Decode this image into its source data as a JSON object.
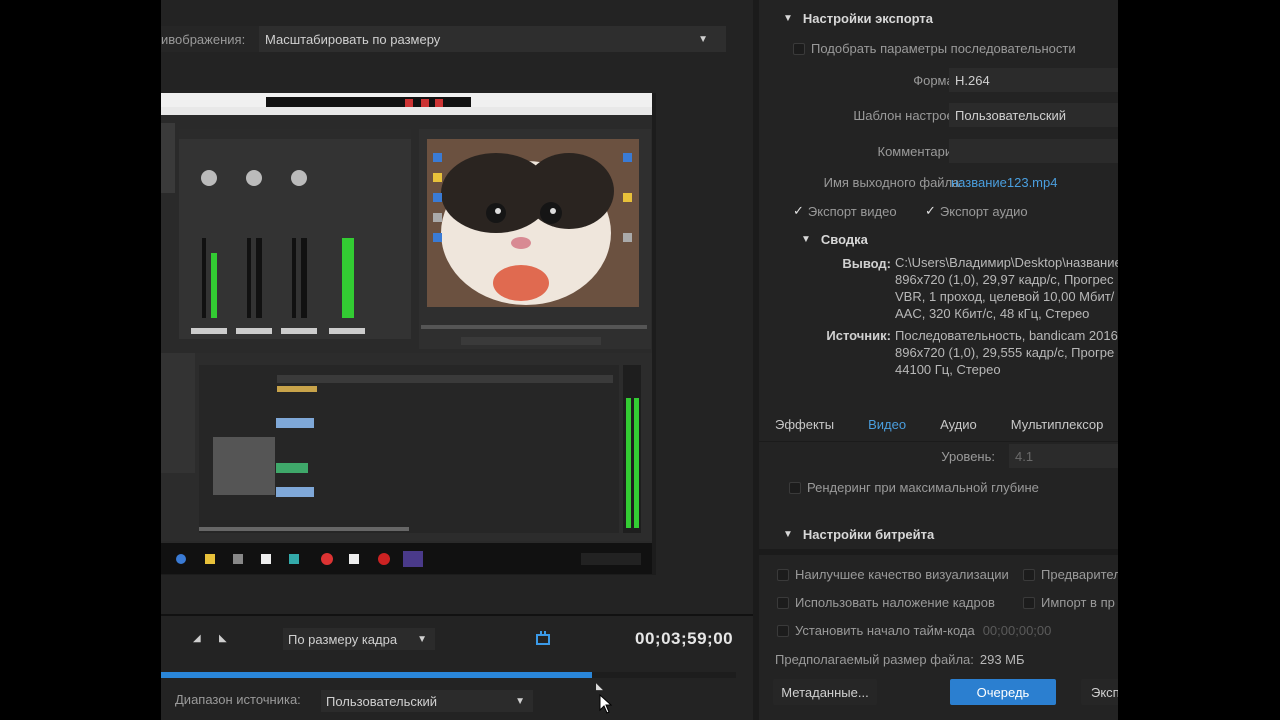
{
  "left": {
    "scale_label": "ивображения:",
    "scale_value": "Масштабировать по размеру",
    "fit_value": "По размеру кадра",
    "timecode": "00;03;59;00",
    "progress": 0.75,
    "range_label": "Диапазон источника:",
    "range_value": "Пользовательский"
  },
  "right": {
    "export_settings_title": "Настройки экспорта",
    "match_sequence_label": "Подобрать параметры последовательности",
    "format_label": "Формат:",
    "format_value": "H.264",
    "preset_label": "Шаблон настроек:",
    "preset_value": "Пользовательский",
    "comments_label": "Комментарии:",
    "output_name_label": "Имя выходного файла:",
    "output_name_value": "название123.mp4",
    "export_video_label": "Экспорт видео",
    "export_audio_label": "Экспорт аудио",
    "summary_title": "Сводка",
    "output_label": "Вывод:",
    "output_lines": [
      "C:\\Users\\Владимир\\Desktop\\название",
      "896x720 (1,0), 29,97 кадр/с, Прогрес",
      "VBR, 1 проход, целевой 10,00 Мбит/",
      "AAC, 320 Кбит/с, 48 кГц, Стерео"
    ],
    "source_label": "Источник:",
    "source_lines": [
      "Последовательность, bandicam 2016",
      "896x720 (1,0), 29,555 кадр/с, Прогре",
      "44100 Гц, Стерео"
    ],
    "tabs": [
      "Эффекты",
      "Видео",
      "Аудио",
      "Мультиплексор"
    ],
    "active_tab": "Видео",
    "level_label": "Уровень:",
    "level_value": "4.1",
    "max_depth_label": "Рендеринг при максимальной глубине",
    "bitrate_title": "Настройки битрейта",
    "best_quality_label": "Наилучшее качество визуализации",
    "preview_label": "Предварител",
    "frame_blend_label": "Использовать наложение кадров",
    "import_label": "Импорт в пр",
    "start_timecode_label": "Установить начало тайм-кода",
    "start_timecode_value": "00;00;00;00",
    "estimated_size_label": "Предполагаемый размер файла:",
    "estimated_size_value": "293 МБ",
    "metadata_button": "Метаданные...",
    "queue_button": "Очередь",
    "export_button": "Экспо"
  },
  "colors": {
    "accent": "#2b7fd0",
    "link": "#4a9ede",
    "panel": "#232323"
  }
}
